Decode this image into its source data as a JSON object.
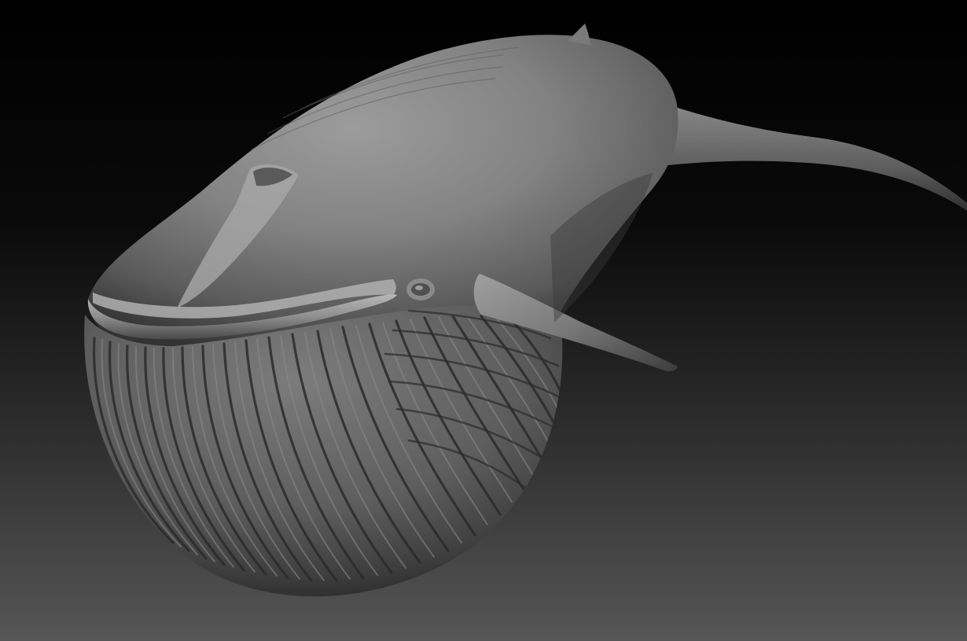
{
  "scene": {
    "subject": "whale-sculpt",
    "colors": {
      "background_top": "#000000",
      "background_bottom": "#555555",
      "clay_light": "#9a9a9a",
      "clay_mid": "#6e6e6e",
      "clay_dark": "#2a2a2a"
    }
  }
}
